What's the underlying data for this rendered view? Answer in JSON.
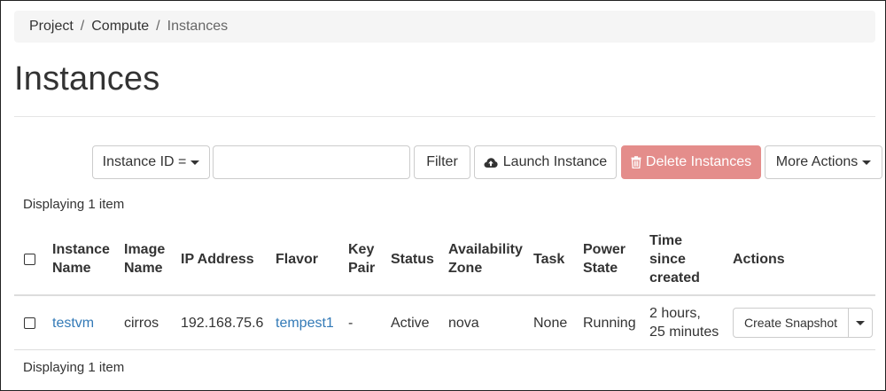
{
  "breadcrumb": {
    "items": [
      "Project",
      "Compute"
    ],
    "separator": "/",
    "current": "Instances"
  },
  "page": {
    "title": "Instances"
  },
  "toolbar": {
    "filter_field_label": "Instance ID =",
    "filter_input_value": "",
    "filter_button": "Filter",
    "launch_button": "Launch Instance",
    "launch_icon": "cloud-upload-icon",
    "delete_button": "Delete Instances",
    "delete_icon": "trash-icon",
    "more_actions_button": "More Actions"
  },
  "status": {
    "displaying_top": "Displaying 1 item",
    "displaying_bottom": "Displaying 1 item"
  },
  "table": {
    "headers": {
      "instance_name": [
        "Instance",
        "Name"
      ],
      "image_name": [
        "Image",
        "Name"
      ],
      "ip_address": [
        "IP Address"
      ],
      "flavor": [
        "Flavor"
      ],
      "key_pair": [
        "Key",
        "Pair"
      ],
      "status": [
        "Status"
      ],
      "availability_zone": [
        "Availability",
        "Zone"
      ],
      "task": [
        "Task"
      ],
      "power_state": [
        "Power",
        "State"
      ],
      "time_since_created": [
        "Time",
        "since",
        "created"
      ],
      "actions": [
        "Actions"
      ]
    },
    "rows": [
      {
        "instance_name": "testvm",
        "image_name": "cirros",
        "ip_address": "192.168.75.6",
        "flavor": "tempest1",
        "key_pair": "-",
        "status": "Active",
        "availability_zone": "nova",
        "task": "None",
        "power_state": "Running",
        "time_since_created": [
          "2 hours,",
          "25 minutes"
        ],
        "action_button": "Create Snapshot"
      }
    ]
  },
  "colors": {
    "link": "#337ab7",
    "danger_button": "#e48d8b",
    "breadcrumb_bg": "#f5f5f5"
  }
}
